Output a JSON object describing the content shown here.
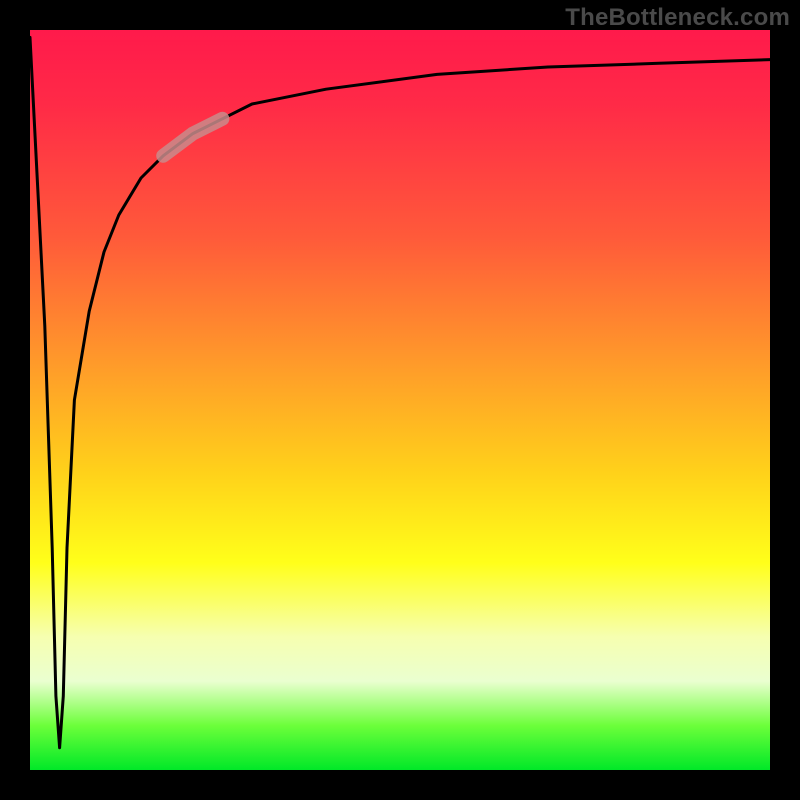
{
  "watermark": {
    "text": "TheBottleneck.com"
  },
  "colors": {
    "frame": "#000000",
    "watermark": "#4a4a4a",
    "curve": "#000000",
    "highlight": "#c98b8b",
    "gradient_stops": [
      "#ff1a4b",
      "#ff2a47",
      "#ff5a3a",
      "#ff9a2a",
      "#ffd21a",
      "#ffff1a",
      "#f6ffb0",
      "#eaffd0",
      "#6cff3a",
      "#00e828"
    ]
  },
  "chart_data": {
    "type": "line",
    "title": "",
    "xlabel": "",
    "ylabel": "",
    "xlim": [
      0,
      100
    ],
    "ylim": [
      0,
      100
    ],
    "grid": false,
    "legend": false,
    "note": "Axis values are normalized 0–100 estimates; the image has no tick labels.",
    "series": [
      {
        "name": "curve",
        "x": [
          0,
          2,
          3,
          3.5,
          4,
          4.5,
          5,
          6,
          8,
          10,
          12,
          15,
          18,
          22,
          26,
          30,
          40,
          55,
          70,
          85,
          100
        ],
        "y": [
          99,
          60,
          30,
          10,
          3,
          10,
          30,
          50,
          62,
          70,
          75,
          80,
          83,
          86,
          88,
          90,
          92,
          94,
          95,
          95.5,
          96
        ]
      }
    ],
    "highlight_segment": {
      "series": "curve",
      "x_start": 18,
      "x_end": 26,
      "note": "Thicker pale-red overlay on the main curve in this x-range."
    }
  }
}
